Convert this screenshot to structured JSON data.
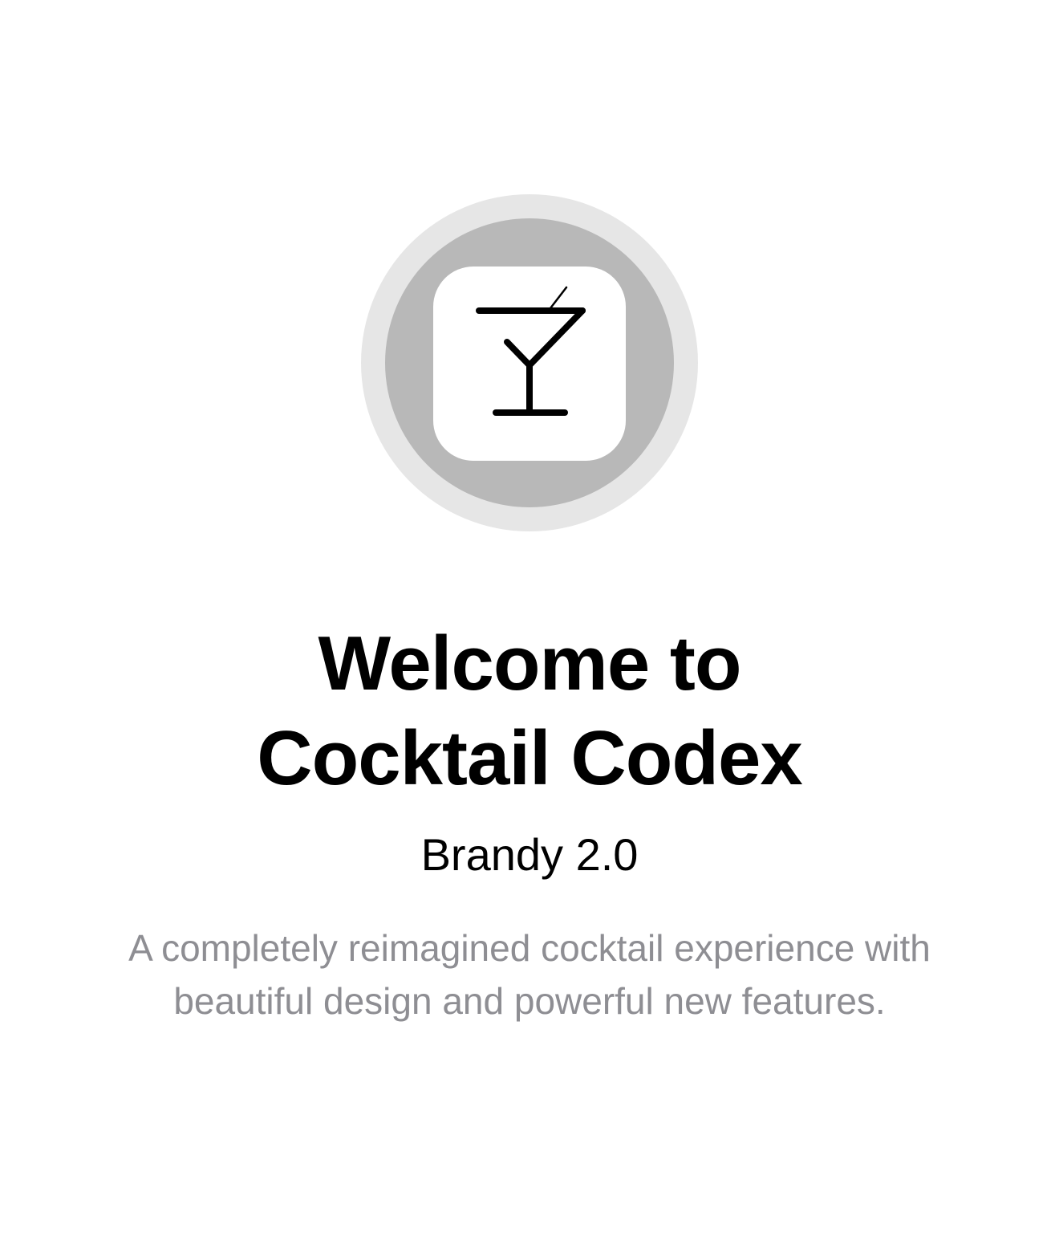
{
  "app_icon": {
    "icon": "cocktail-glass-icon",
    "halo_color": "#e6e6e6",
    "ring_color": "#b8b8b8",
    "tile_color": "#ffffff",
    "glyph_color": "#000000"
  },
  "welcome": {
    "title_line_1": "Welcome to",
    "title_line_2": "Cocktail Codex",
    "version": "Brandy 2.0",
    "description_line_1": "A completely reimagined cocktail experience with",
    "description_line_2": "beautiful design and powerful new features.",
    "description_color": "#8e8e93"
  }
}
